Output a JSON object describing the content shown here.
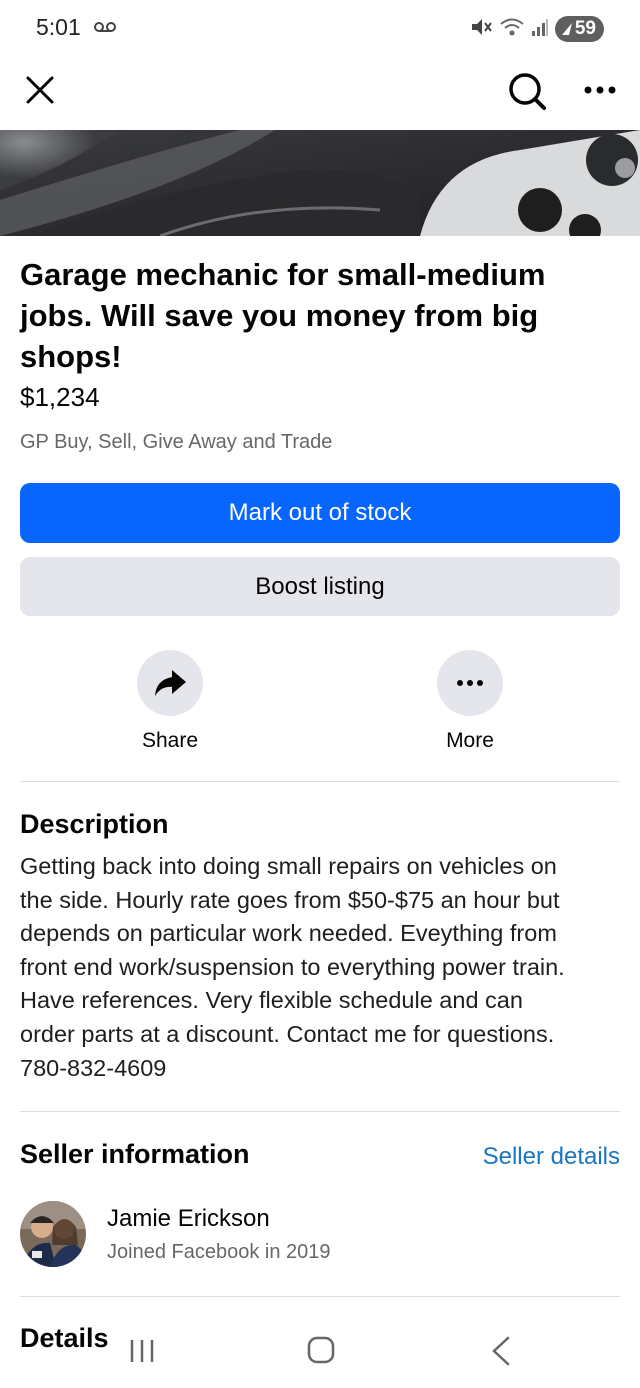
{
  "status_bar": {
    "time": "5:01",
    "voicemail_icon": "voicemail-icon",
    "mute_icon": "vibrate-mute-icon",
    "wifi_icon": "wifi-icon",
    "signal_icon": "signal-icon",
    "battery": "59"
  },
  "app_bar": {
    "close_icon": "close-icon",
    "search_icon": "search-icon",
    "more_icon": "more-horizontal-icon"
  },
  "listing": {
    "title": "Garage mechanic for small-medium jobs. Will save you money from big shops!",
    "price": "$1,234",
    "group": "GP Buy, Sell, Give Away and Trade",
    "mark_out_of_stock": "Mark out of stock",
    "boost_listing": "Boost listing"
  },
  "actions": {
    "share_label": "Share",
    "more_label": "More"
  },
  "description": {
    "heading": "Description",
    "lines": [
      "Getting back into doing small repairs on vehicles on",
      "the side. Hourly rate goes from $50-$75 an hour but",
      "depends on particular work needed. Eveything from",
      "front end work/suspension to everything power train.",
      "Have references. Very flexible schedule and can",
      "order parts at a discount. Contact me for questions.",
      "780-832-4609"
    ]
  },
  "seller": {
    "heading": "Seller information",
    "details_link": "Seller details",
    "name": "Jamie Erickson",
    "joined": "Joined Facebook in 2019"
  },
  "details": {
    "heading": "Details"
  },
  "colors": {
    "primary": "#0866ff",
    "secondary_bg": "#e4e6eb",
    "muted_text": "#65676b",
    "link": "#1877c4"
  }
}
